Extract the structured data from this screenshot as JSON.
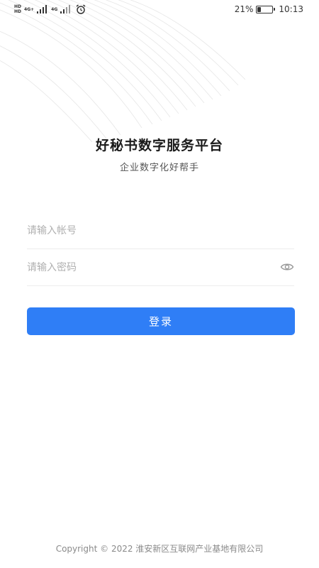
{
  "status_bar": {
    "sim1_label": "HD",
    "sim2_label": "HD",
    "network1": "4G+",
    "network2": "4G",
    "battery_percent": "21%",
    "battery_level": 0.21,
    "time": "10:13",
    "icons": [
      "signal-icon",
      "signal-icon",
      "alarm-icon",
      "battery-icon"
    ]
  },
  "header": {
    "title": "好秘书数字服务平台",
    "subtitle": "企业数字化好帮手"
  },
  "form": {
    "account_placeholder": "请输入帐号",
    "password_placeholder": "请输入密码",
    "eye_icon": "eye-icon",
    "login_label": "登录"
  },
  "footer": {
    "copyright": "Copyright © 2022 淮安新区互联网产业基地有限公司"
  },
  "colors": {
    "primary": "#2f7ef6",
    "placeholder": "#b0b0b0",
    "divider": "#ececec"
  }
}
